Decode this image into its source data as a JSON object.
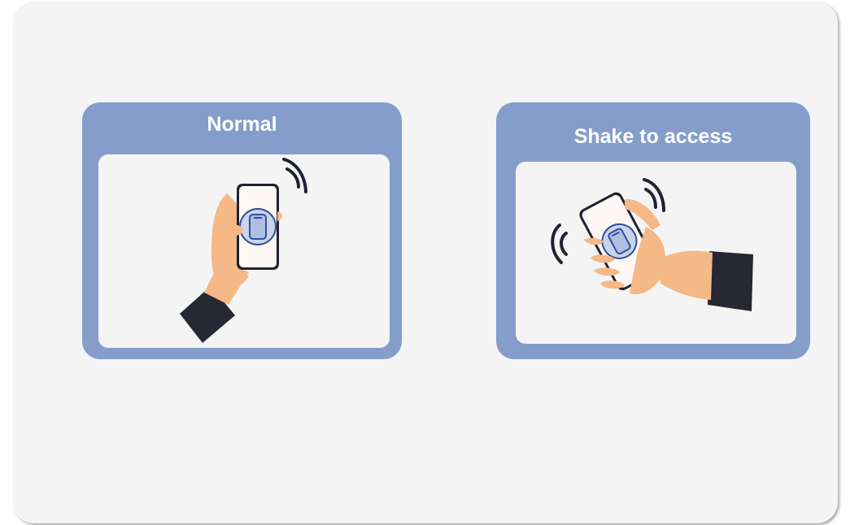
{
  "cards": [
    {
      "title": "Normal",
      "illustration": "hand-holding-phone-icon"
    },
    {
      "title": "Shake to access",
      "illustration": "hand-shaking-phone-icon"
    }
  ],
  "colors": {
    "panel_background": "#f4f4f4",
    "card_background": "#849dcb",
    "title_text": "#ffffff",
    "skin": "#f4b987",
    "sleeve": "#262833",
    "phone_screen": "#fdf8f3",
    "icon_blue": "#2f4f9e"
  }
}
